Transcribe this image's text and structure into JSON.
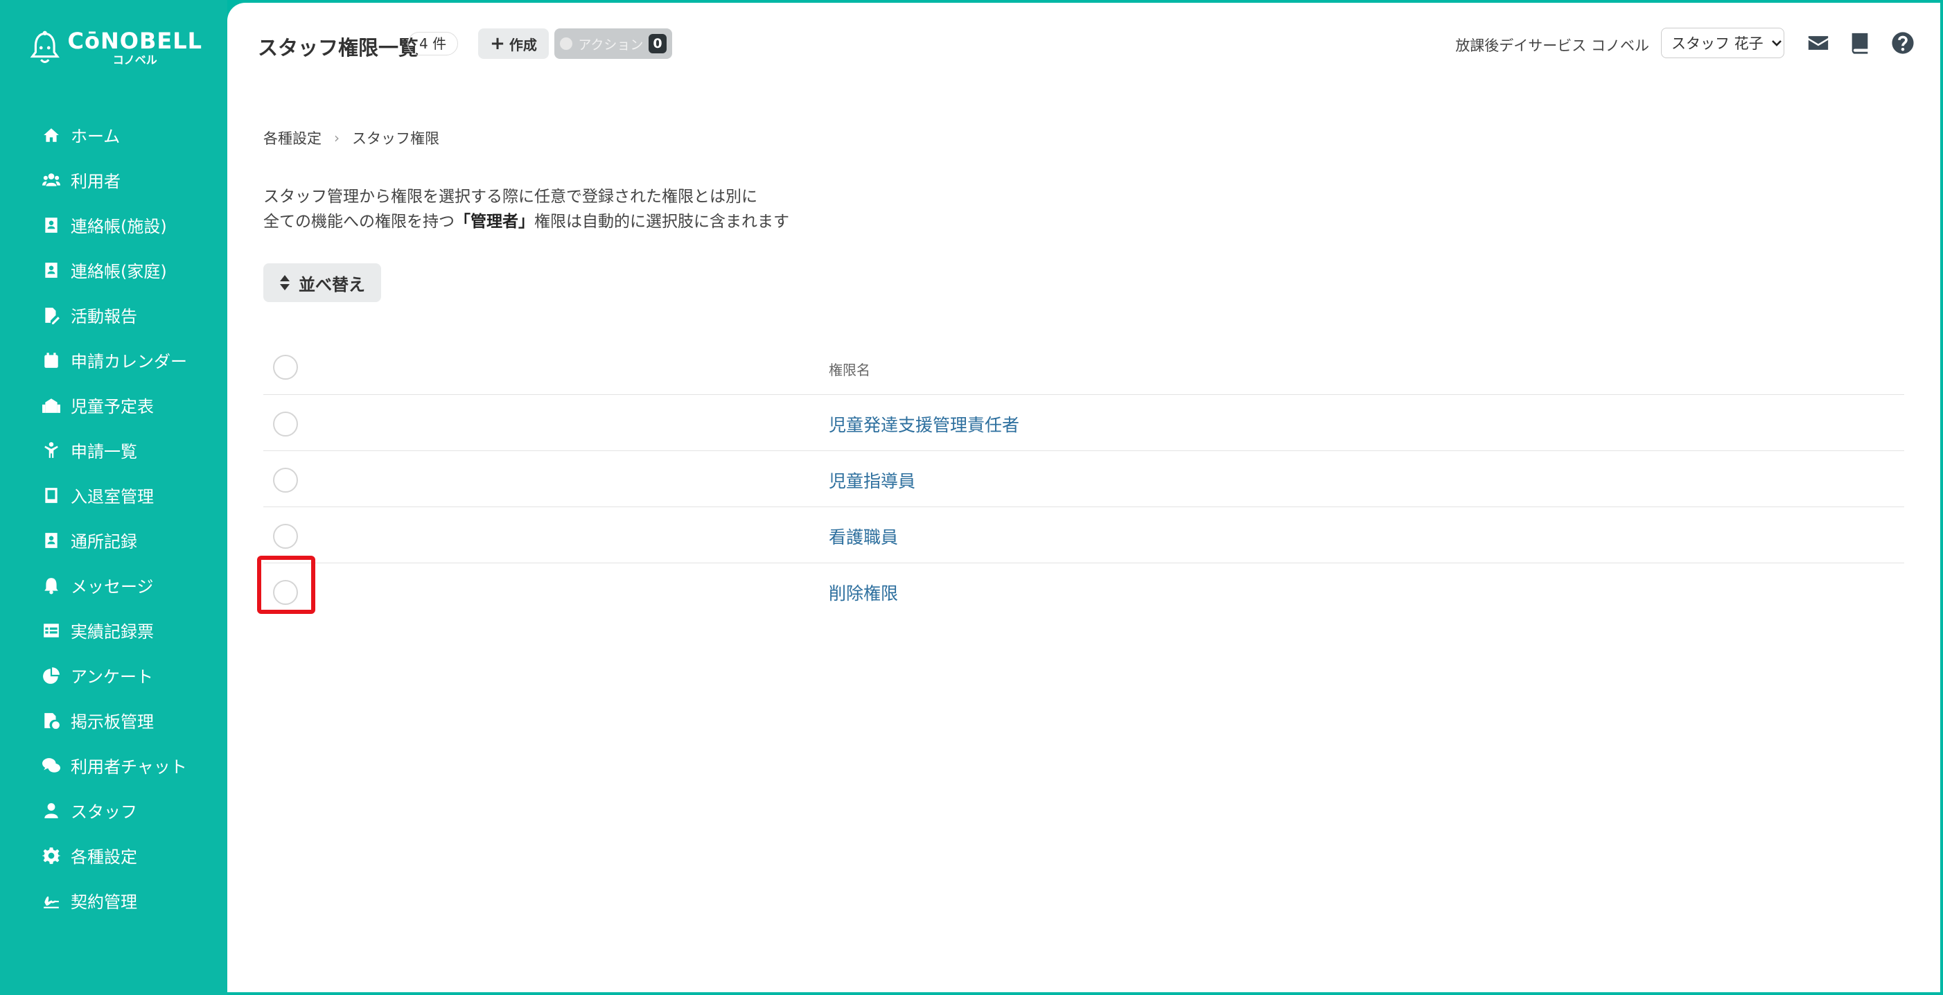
{
  "brand": {
    "name": "CōNOBELL",
    "sub": "コノベル"
  },
  "sidebar": {
    "items": [
      {
        "label": "ホーム",
        "icon": "home-icon"
      },
      {
        "label": "利用者",
        "icon": "users-icon"
      },
      {
        "label": "連絡帳(施設)",
        "icon": "contact-book-icon"
      },
      {
        "label": "連絡帳(家庭)",
        "icon": "contact-book-icon"
      },
      {
        "label": "活動報告",
        "icon": "file-edit-icon"
      },
      {
        "label": "申請カレンダー",
        "icon": "calendar-icon"
      },
      {
        "label": "児童予定表",
        "icon": "school-icon"
      },
      {
        "label": "申請一覧",
        "icon": "child-icon"
      },
      {
        "label": "入退室管理",
        "icon": "tablet-icon"
      },
      {
        "label": "通所記録",
        "icon": "id-card-icon"
      },
      {
        "label": "メッセージ",
        "icon": "bell-icon"
      },
      {
        "label": "実績記録票",
        "icon": "table-icon"
      },
      {
        "label": "アンケート",
        "icon": "pie-chart-icon"
      },
      {
        "label": "掲示板管理",
        "icon": "board-icon"
      },
      {
        "label": "利用者チャット",
        "icon": "chat-icon"
      },
      {
        "label": "スタッフ",
        "icon": "staff-icon"
      },
      {
        "label": "各種設定",
        "icon": "gear-icon"
      },
      {
        "label": "契約管理",
        "icon": "signature-icon"
      }
    ]
  },
  "header": {
    "title": "スタッフ権限一覧",
    "count": "4 件",
    "create_label": "作成",
    "action_label": "アクション",
    "action_count": "0",
    "facility": "放課後デイサービス コノベル",
    "user": "スタッフ 花子"
  },
  "breadcrumb": [
    "各種設定",
    "スタッフ権限"
  ],
  "description": {
    "line1": "スタッフ管理から権限を選択する際に任意で登録された権限とは別に",
    "line2_prefix": "全ての機能への権限を持つ",
    "line2_bold": "「管理者」",
    "line2_suffix": "権限は自動的に選択肢に含まれます"
  },
  "sort_label": "並べ替え",
  "table": {
    "column_header": "権限名",
    "rows": [
      "児童発達支援管理責任者",
      "児童指導員",
      "看護職員",
      "削除権限"
    ]
  },
  "colors": {
    "accent": "#0bb8a6",
    "link": "#2d6f9e",
    "highlight": "#e8131b"
  }
}
